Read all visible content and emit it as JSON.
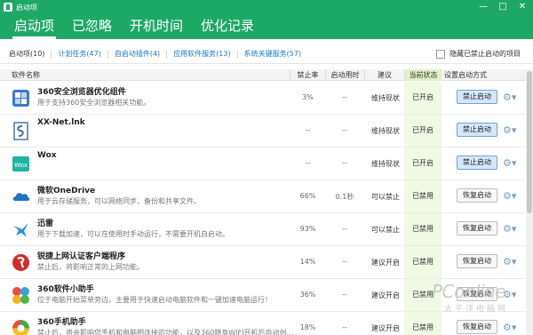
{
  "window": {
    "title": "启动项",
    "controls": {
      "minimize": "—",
      "maximize": "□",
      "close": "✕"
    }
  },
  "tabs": [
    {
      "label": "启动项",
      "active": true
    },
    {
      "label": "已忽略",
      "active": false
    },
    {
      "label": "开机时间",
      "active": false
    },
    {
      "label": "优化记录",
      "active": false
    }
  ],
  "filters": [
    {
      "label": "启动项(10)",
      "active": true
    },
    {
      "label": "计划任务(47)",
      "active": false
    },
    {
      "label": "自启动插件(4)",
      "active": false
    },
    {
      "label": "应用软件服务(13)",
      "active": false
    },
    {
      "label": "系统关键服务(57)",
      "active": false
    }
  ],
  "hide_disabled_label": "隐藏已禁止启动的项目",
  "columns": {
    "name": "软件名称",
    "disable_rate": "禁止率",
    "startup_time": "启动用时",
    "advice": "建议",
    "current_state": "当前状态",
    "setting": "设置启动方式"
  },
  "rows": [
    {
      "name": "360安全浏览器优化组件",
      "desc": "用于支持360安全浏览器相关功能。",
      "rate": "3%",
      "time": "--",
      "advice": "维持现状",
      "state": "已开启",
      "action": "禁止启动",
      "icon": "browser-component-icon",
      "icon_color": "#3b78c9"
    },
    {
      "name": "XX-Net.lnk",
      "desc": "",
      "rate": "--",
      "time": "--",
      "advice": "维持现状",
      "state": "已开启",
      "action": "禁止启动",
      "icon": "script-file-icon",
      "icon_color": "#3f6e96"
    },
    {
      "name": "Wox",
      "desc": "",
      "rate": "--",
      "time": "--",
      "advice": "维持现状",
      "state": "已开启",
      "action": "禁止启动",
      "icon": "wox-icon",
      "icon_color": "#1cb5a3"
    },
    {
      "name": "微软OneDrive",
      "desc": "用于云存储服务，可以网络同步、备份和共享文件。",
      "rate": "66%",
      "time": "0.1秒",
      "advice": "可以禁止",
      "state": "已禁用",
      "action": "恢复启动",
      "icon": "onedrive-cloud-icon",
      "icon_color": "#1e72c8"
    },
    {
      "name": "迅雷",
      "desc": "用于下载加速，可以在使用时手动运行，不需要开机自启动。",
      "rate": "93%",
      "time": "--",
      "advice": "可以禁止",
      "state": "已禁用",
      "action": "恢复启动",
      "icon": "thunder-bird-icon",
      "icon_color": "#2a8fd8"
    },
    {
      "name": "锐捷上网认证客户端程序",
      "desc": "禁止后，将影响正常的上网功能。",
      "rate": "14%",
      "time": "--",
      "advice": "建议开启",
      "state": "已禁用",
      "action": "恢复启动",
      "icon": "ruijie-red-icon",
      "icon_color": "#d22b2b"
    },
    {
      "name": "360软件小助手",
      "desc": "位于电脑开始菜单旁边，主要用于快速启动电脑软件和一键加速电脑运行！",
      "rate": "36%",
      "time": "--",
      "advice": "建议开启",
      "state": "已禁用",
      "action": "恢复启动",
      "icon": "360-assistant-icon",
      "icon_color": "#e94e3b"
    },
    {
      "name": "360手机助手",
      "desc": "禁止后，将会影响您手机和电脑相连接的功能，以及360随身WIFI开机后自动创…",
      "rate": "18%",
      "time": "--",
      "advice": "建议开启",
      "state": "已禁用",
      "action": "恢复启动",
      "icon": "360-phone-assistant-icon",
      "icon_color": "#3ab04c"
    }
  ],
  "watermark": {
    "main": "PConline",
    "sub": "太平洋电脑网"
  }
}
